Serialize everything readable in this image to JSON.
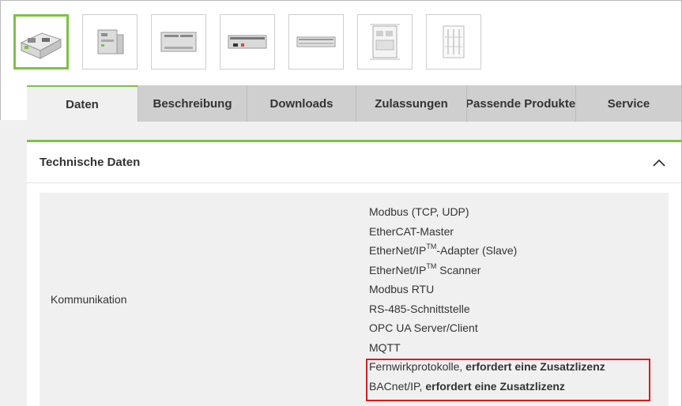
{
  "thumbnails": [
    {
      "name": "product-photo-1",
      "active": true
    },
    {
      "name": "product-photo-2",
      "active": false
    },
    {
      "name": "product-photo-3",
      "active": false
    },
    {
      "name": "product-photo-4",
      "active": false
    },
    {
      "name": "product-photo-5",
      "active": false
    },
    {
      "name": "dimension-drawing-1",
      "active": false
    },
    {
      "name": "dimension-drawing-2",
      "active": false
    }
  ],
  "tabs": [
    {
      "label": "Daten",
      "active": true
    },
    {
      "label": "Beschreibung",
      "active": false
    },
    {
      "label": "Downloads",
      "active": false
    },
    {
      "label": "Zulassungen",
      "active": false
    },
    {
      "label": "Passende Produkte",
      "active": false
    },
    {
      "label": "Service",
      "active": false
    }
  ],
  "section": {
    "title": "Technische Daten",
    "toggle_icon": "chevron-up-icon"
  },
  "spec_row": {
    "label": "Kommunikation",
    "values": {
      "modbus_tcp": "Modbus (TCP, UDP)",
      "ethercat": "EtherCAT-Master",
      "ethernetip_adapter_pre": "EtherNet/IP",
      "ethernetip_adapter_tm": "TM",
      "ethernetip_adapter_post": "-Adapter (Slave)",
      "ethernetip_scanner_pre": "EtherNet/IP",
      "ethernetip_scanner_tm": "TM",
      "ethernetip_scanner_post": " Scanner",
      "modbus_rtu": "Modbus RTU",
      "rs485": "RS-485-Schnittstelle",
      "opcua": "OPC UA Server/Client",
      "mqtt": "MQTT",
      "fernwirk_pre": "Fernwirkprotokolle, ",
      "fernwirk_bold": "erfordert eine Zusatzlizenz",
      "bacnet_pre": "BACnet/IP, ",
      "bacnet_bold": "erfordert eine Zusatzlizenz"
    }
  },
  "colors": {
    "accent": "#7cc242",
    "highlight_box": "#e0191c",
    "tab_inactive": "#cfcfcf",
    "panel_bg": "#f0f0f0"
  }
}
